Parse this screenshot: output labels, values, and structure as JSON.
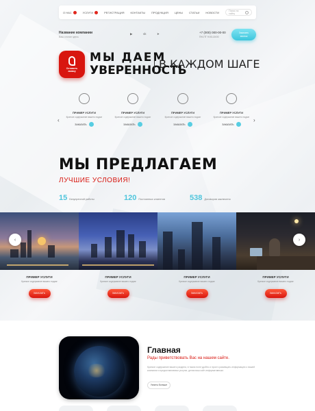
{
  "nav": {
    "items": [
      {
        "label": "О нас",
        "badge": true
      },
      {
        "label": "Услуги",
        "badge": true
      },
      {
        "label": "Регистрация",
        "badge": false
      },
      {
        "label": "Контакты",
        "badge": false
      },
      {
        "label": "Продукция",
        "badge": false
      },
      {
        "label": "Цены",
        "badge": false
      },
      {
        "label": "Статьи",
        "badge": false
      },
      {
        "label": "Новости",
        "badge": false
      }
    ],
    "search_placeholder": "Поиск по сайту"
  },
  "header": {
    "company_name": "Название компании",
    "company_slogan": "Ваш слоган здесь",
    "social_icons": [
      "youtube-icon",
      "vk-icon",
      "telegram-icon"
    ],
    "phone": "+7 (000) 000-00-00",
    "phone_sub": "ПН-ПТ 9:00-18:00",
    "cta_line1": "Заказать",
    "cta_line2": "звонок"
  },
  "headline": {
    "logo_text_1": "Оставить",
    "logo_text_2": "заявку",
    "line1": "МЫ ДАЕМ",
    "line2": "УВЕРЕННОСТЬ",
    "line3": "В КАЖДОМ ШАГЕ"
  },
  "services": [
    {
      "title": "ПРИМЕР УСЛУГИ",
      "desc": "Краткое содержание вашего подзаг",
      "button": "ЗАКАЗАТЬ",
      "icon": "target-icon"
    },
    {
      "title": "ПРИМЕР УСЛУГИ",
      "desc": "Краткое содержание вашего подзаг",
      "button": "ЗАКАЗАТЬ",
      "icon": "timer-icon"
    },
    {
      "title": "ПРИМЕР УСЛУГИ",
      "desc": "Краткое содержание вашего подзаг",
      "button": "ЗАКАЗАТЬ",
      "icon": "document-icon"
    },
    {
      "title": "ПРИМЕР УСЛУГИ",
      "desc": "Краткое содержание вашего подзаг",
      "button": "ЗАКАЗАТЬ",
      "icon": "coffee-icon"
    }
  ],
  "offer": {
    "title": "МЫ ПРЕДЛАГАЕМ",
    "subtitle": "ЛУЧШИЕ УСЛОВИЯ!",
    "stats": [
      {
        "value": "15",
        "label": "Безупречной работы"
      },
      {
        "value": "120",
        "label": "Постоянных клиентов"
      },
      {
        "value": "538",
        "label": "Договоров заключено"
      }
    ]
  },
  "cards": [
    {
      "title": "ПРИМЕР УСЛУГИ",
      "desc": "Краткое содержание вашего подзаг",
      "button": "ЗАКАЗАТЬ"
    },
    {
      "title": "ПРИМЕР УСЛУГИ",
      "desc": "Краткое содержание вашего подзаг",
      "button": "ЗАКАЗАТЬ"
    },
    {
      "title": "ПРИМЕР УСЛУГИ",
      "desc": "Краткое содержание вашего подзаг",
      "button": "ЗАКАЗАТЬ"
    },
    {
      "title": "ПРИМЕР УСЛУГИ",
      "desc": "Краткое содержание вашего подзаг",
      "button": "ЗАКАЗАТЬ"
    }
  ],
  "welcome": {
    "title": "Главная",
    "subtitle": "Рады приветствовать Вас на нашем сайте.",
    "text": "Краткое содержание вашего раздела, в таком поле удобно и просто размещать информацию о вашей компании и предоставляемых услугах, делая ваш сайт информативным.",
    "button": "Узнать больше"
  },
  "colors": {
    "accent_red": "#d8160f",
    "accent_cyan": "#4fc5dc"
  }
}
